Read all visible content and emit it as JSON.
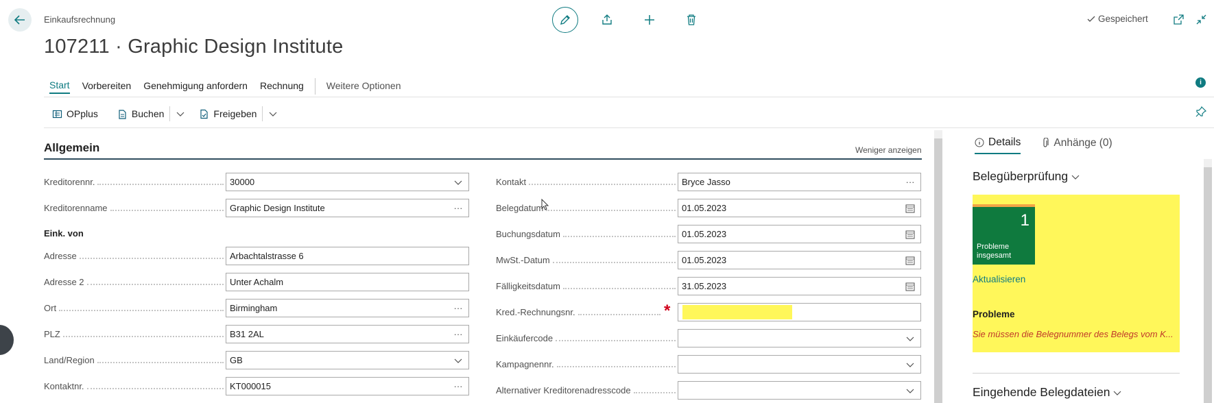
{
  "header": {
    "breadcrumb": "Einkaufsrechnung",
    "title": "107211 · Graphic Design Institute",
    "saved_label": "Gespeichert",
    "icons": [
      "back-arrow-icon",
      "edit-pencil-icon",
      "share-icon",
      "plus-icon",
      "trash-icon",
      "open-new-window-icon",
      "collapse-icon"
    ]
  },
  "actions": {
    "tabs": [
      "Start",
      "Vorbereiten",
      "Genehmigung anfordern",
      "Rechnung"
    ],
    "more": "Weitere Optionen",
    "active": "Start"
  },
  "toolbar": {
    "opplus": "OPplus",
    "post": "Buchen",
    "release": "Freigeben"
  },
  "general": {
    "title": "Allgemein",
    "show_less": "Weniger anzeigen",
    "left": {
      "vendor_no_label": "Kreditorennr.",
      "vendor_no": "30000",
      "vendor_name_label": "Kreditorenname",
      "vendor_name": "Graphic Design Institute",
      "buy_from_heading": "Eink. von",
      "address_label": "Adresse",
      "address": "Arbachtalstrasse 6",
      "address2_label": "Adresse 2",
      "address2": "Unter Achalm",
      "city_label": "Ort",
      "city": "Birmingham",
      "postcode_label": "PLZ",
      "postcode": "B31 2AL",
      "country_label": "Land/Region",
      "country": "GB",
      "contact_no_label": "Kontaktnr.",
      "contact_no": "KT000015"
    },
    "right": {
      "contact_label": "Kontakt",
      "contact": "Bryce Jasso",
      "doc_date_label": "Belegdatum",
      "doc_date": "01.05.2023",
      "posting_date_label": "Buchungsdatum",
      "posting_date": "01.05.2023",
      "vat_date_label": "MwSt.-Datum",
      "vat_date": "01.05.2023",
      "due_date_label": "Fälligkeitsdatum",
      "due_date": "31.05.2023",
      "vendor_invoice_label": "Kred.-Rechnungsnr.",
      "vendor_invoice": "",
      "purchaser_label": "Einkäufercode",
      "purchaser": "",
      "campaign_label": "Kampagnennr.",
      "campaign": "",
      "alt_address_label": "Alternativer Kreditorenadresscode",
      "alt_address": ""
    }
  },
  "factbox": {
    "tab_details": "Details",
    "tab_attachments": "Anhänge (0)",
    "doc_check_title": "Belegüberprüfung",
    "tile_count": "1",
    "tile_label": "Probleme insgesamt",
    "refresh": "Aktualisieren",
    "problems_title": "Probleme",
    "problem_message": "Sie müssen die Belegnummer des Belegs vom K...",
    "incoming_title": "Eingehende Belegdateien"
  },
  "colors": {
    "accent": "#0f7b81",
    "highlight": "#fff75a",
    "tile": "#0f7a3e",
    "error": "#c0392b"
  }
}
